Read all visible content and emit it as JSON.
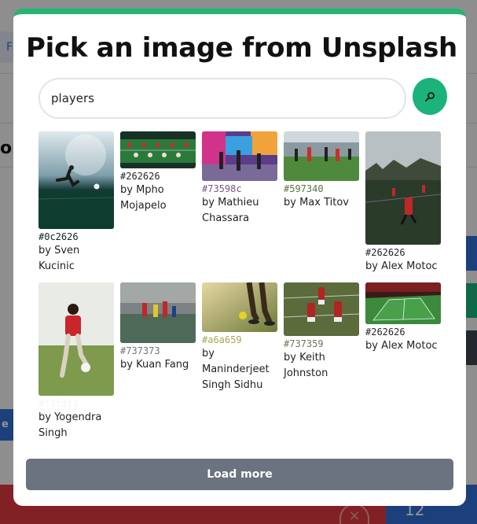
{
  "background": {
    "pill_text": "F",
    "heading_fragment": "or",
    "left_button_fragment": "e c",
    "bottom_counter": "12",
    "bottom_close": "×"
  },
  "modal": {
    "title": "Pick an image from Unsplash",
    "accent_color": "#22b573",
    "search": {
      "value": "players",
      "placeholder": "",
      "button_icon": "search-icon"
    },
    "load_more_label": "Load more"
  },
  "results": [
    {
      "hex": "#0c2626",
      "credit": "by Sven Kucinic",
      "hex_color": "#0c2626"
    },
    {
      "hex": "#262626",
      "credit": "by Mpho Mojapelo",
      "hex_color": "#262626"
    },
    {
      "hex": "#73598c",
      "credit": "by Mathieu Chassara",
      "hex_color": "#73598c"
    },
    {
      "hex": "#597340",
      "credit": "by Max Titov",
      "hex_color": "#597340"
    },
    {
      "hex": "#262626",
      "credit": "by Alex Motoc",
      "hex_color": "#262626"
    },
    {
      "hex": "#f3f3f3",
      "credit": "by Yogendra Singh",
      "hex_color": "#f3f3f3"
    },
    {
      "hex": "#737373",
      "credit": "by Kuan Fang",
      "hex_color": "#737373"
    },
    {
      "hex": "#a6a659",
      "credit": "by Maninderjeet Singh Sidhu",
      "hex_color": "#a6a659"
    },
    {
      "hex": "#737359",
      "credit": "by Keith Johnston",
      "hex_color": "#737359"
    },
    {
      "hex": "#262626",
      "credit": "by Alex Motoc",
      "hex_color": "#262626"
    }
  ]
}
